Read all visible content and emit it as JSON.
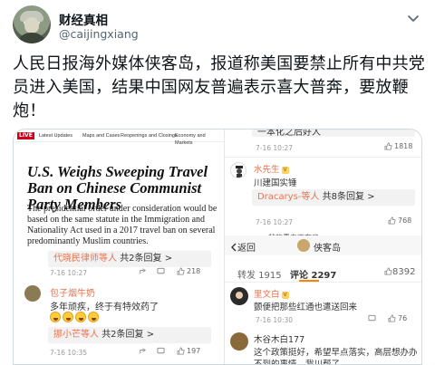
{
  "tweet": {
    "display_name": "财经真相",
    "handle": "@caijingxiang",
    "text": "人民日报海外媒体侠客岛，报道称美国要禁止所有中共党员进入美国，结果中国网友普遍表示喜大普奔，要放鞭炮！"
  },
  "nyt": {
    "live_label": "LIVE",
    "nav": [
      "Latest Updates",
      "Maps and Cases",
      "Reopenings and Closings",
      "Economy and Markets"
    ],
    "headline": "U.S. Weighs Sweeping Travel Ban on Chinese Communist Party Members",
    "body": "The presidential order under consideration would be based on the same statute in the Immigration and Nationality Act used in a 2017 travel ban on several predominantly Muslim countries."
  },
  "left_comments": {
    "reply1": {
      "who": "代晓民律师等人",
      "count": "共2条回复 >"
    },
    "meta1": "7-16 10:27",
    "likes1": "218",
    "comment2": {
      "name": "包子烟牛奶",
      "text": "多年顽疾，终于有特效药了"
    },
    "reply2": {
      "who": "挪小芒等人",
      "count": "共2条回复 >"
    },
    "meta2": "7-16 10:35",
    "likes2": "197"
  },
  "right_comments": {
    "top_partial": "一本化之后好人",
    "meta0": "7-16 10:27",
    "likes0": "1818",
    "c1": {
      "name": "水先生",
      "text": "川建国实锤"
    },
    "reply1": {
      "who": "Dracarys-等人",
      "count": "共8条回复 >"
    },
    "meta1": "7-16 10:27",
    "likes1": "768",
    "partial_line": "爷的青春不在了",
    "weibo_header": {
      "back": "返回",
      "account": "侠客岛"
    },
    "tabs": {
      "repost": "转发 1915",
      "comment": "评论 2297",
      "like": "8392"
    },
    "c2": {
      "name": "里文白",
      "text": "颤便把那些红通也遣送回来"
    },
    "meta2": "7-16 10:30",
    "likes2": "76",
    "c3": {
      "name": "木谷木白177",
      "text": "这个政策挺好，希望早点落实，高层想办办",
      "text2": "不到的事情，我川帮了"
    }
  },
  "colors": {
    "link_orange": "#eb7350",
    "badge": "#ffd25f",
    "live_red": "#d0021b"
  }
}
